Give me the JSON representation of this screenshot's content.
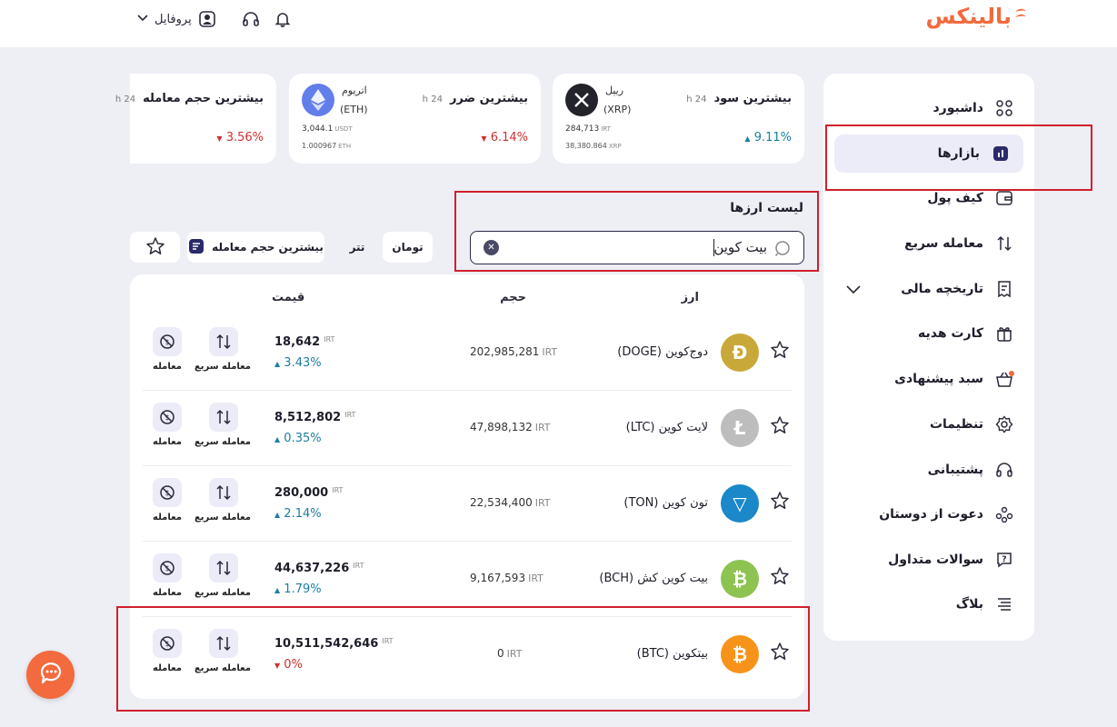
{
  "brand": {
    "logo_text": "بالینکس",
    "accent": "#f26a3d"
  },
  "topbar": {
    "profile_label": "پروفایل"
  },
  "sidebar": {
    "items": [
      {
        "label": "داشبورد",
        "icon": "dashboard-icon"
      },
      {
        "label": "بازارها",
        "icon": "markets-icon",
        "active": true
      },
      {
        "label": "کیف پول",
        "icon": "wallet-icon"
      },
      {
        "label": "معامله سریع",
        "icon": "swap-arrows-icon"
      },
      {
        "label": "تاریخچه مالی",
        "icon": "receipt-icon",
        "has_dropdown": true
      },
      {
        "label": "کارت هدیه",
        "icon": "gift-icon"
      },
      {
        "label": "سبد پیشنهادی",
        "icon": "basket-icon",
        "badge_dot": true
      },
      {
        "label": "تنظیمات",
        "icon": "gear-icon"
      },
      {
        "label": "پشتیبانی",
        "icon": "headphones-icon"
      },
      {
        "label": "دعوت از دوستان",
        "icon": "users-icon"
      },
      {
        "label": "سوالات متداول",
        "icon": "faq-icon"
      },
      {
        "label": "بلاگ",
        "icon": "blog-icon"
      }
    ]
  },
  "cards": [
    {
      "title": "بیشترین سود",
      "period": "24 h",
      "coin_name": "ریپل",
      "coin_symbol": "(XRP)",
      "price_irt": "284,713",
      "price_irt_unit": "IRT",
      "price_alt": "38,380.864",
      "price_alt_unit": "XRP",
      "change": "9.11%",
      "direction": "up"
    },
    {
      "title": "بیشترین ضرر",
      "period": "24 h",
      "coin_name": "اتریوم",
      "coin_symbol": "(ETH)",
      "price_irt": "3,044.1",
      "price_irt_unit": "USDT",
      "price_alt": "1.000967",
      "price_alt_unit": "ETH",
      "change": "6.14%",
      "direction": "down"
    },
    {
      "title": "بیشترین حجم معامله",
      "period": "24 h",
      "change": "3.56%",
      "direction": "down"
    }
  ],
  "list": {
    "title": "لیست ارزها",
    "search_value": "بیت کوین",
    "filters": {
      "toman": "تومان",
      "tether": "تتر",
      "sort_label": "بیشترین حجم معامله"
    },
    "headers": {
      "asset": "ارز",
      "volume": "حجم",
      "price": "قیمت"
    },
    "actions": {
      "quick_trade": "معامله سریع",
      "trade": "معامله"
    },
    "rows": [
      {
        "name": "دوج‌کوین",
        "symbol": "(DOGE)",
        "volume": "202,985,281",
        "unit": "IRT",
        "price": "18,642",
        "change": "3.43%",
        "direction": "up",
        "coin_color": "#c9a83a",
        "glyph": "Ð"
      },
      {
        "name": "لایت کوین",
        "symbol": "(LTC)",
        "volume": "47,898,132",
        "unit": "IRT",
        "price": "8,512,802",
        "change": "0.35%",
        "direction": "up",
        "coin_color": "#bdbdbd",
        "glyph": "Ł"
      },
      {
        "name": "تون کوین",
        "symbol": "(TON)",
        "volume": "22,534,400",
        "unit": "IRT",
        "price": "280,000",
        "change": "2.14%",
        "direction": "up",
        "coin_color": "#1a88c9",
        "glyph": "▽"
      },
      {
        "name": "بیت کوین کش",
        "symbol": "(BCH)",
        "volume": "9,167,593",
        "unit": "IRT",
        "price": "44,637,226",
        "change": "1.79%",
        "direction": "up",
        "coin_color": "#8dc351",
        "glyph": "₿"
      },
      {
        "name": "بیتکوین",
        "symbol": "(BTC)",
        "volume": "0",
        "unit": "IRT",
        "price": "10,511,542,646",
        "change": "0%",
        "direction": "down",
        "coin_color": "#f7931a",
        "glyph": "₿"
      }
    ]
  },
  "colors": {
    "up": "#1b7ea0",
    "down": "#d03030",
    "highlight_box": "#d0202c"
  }
}
